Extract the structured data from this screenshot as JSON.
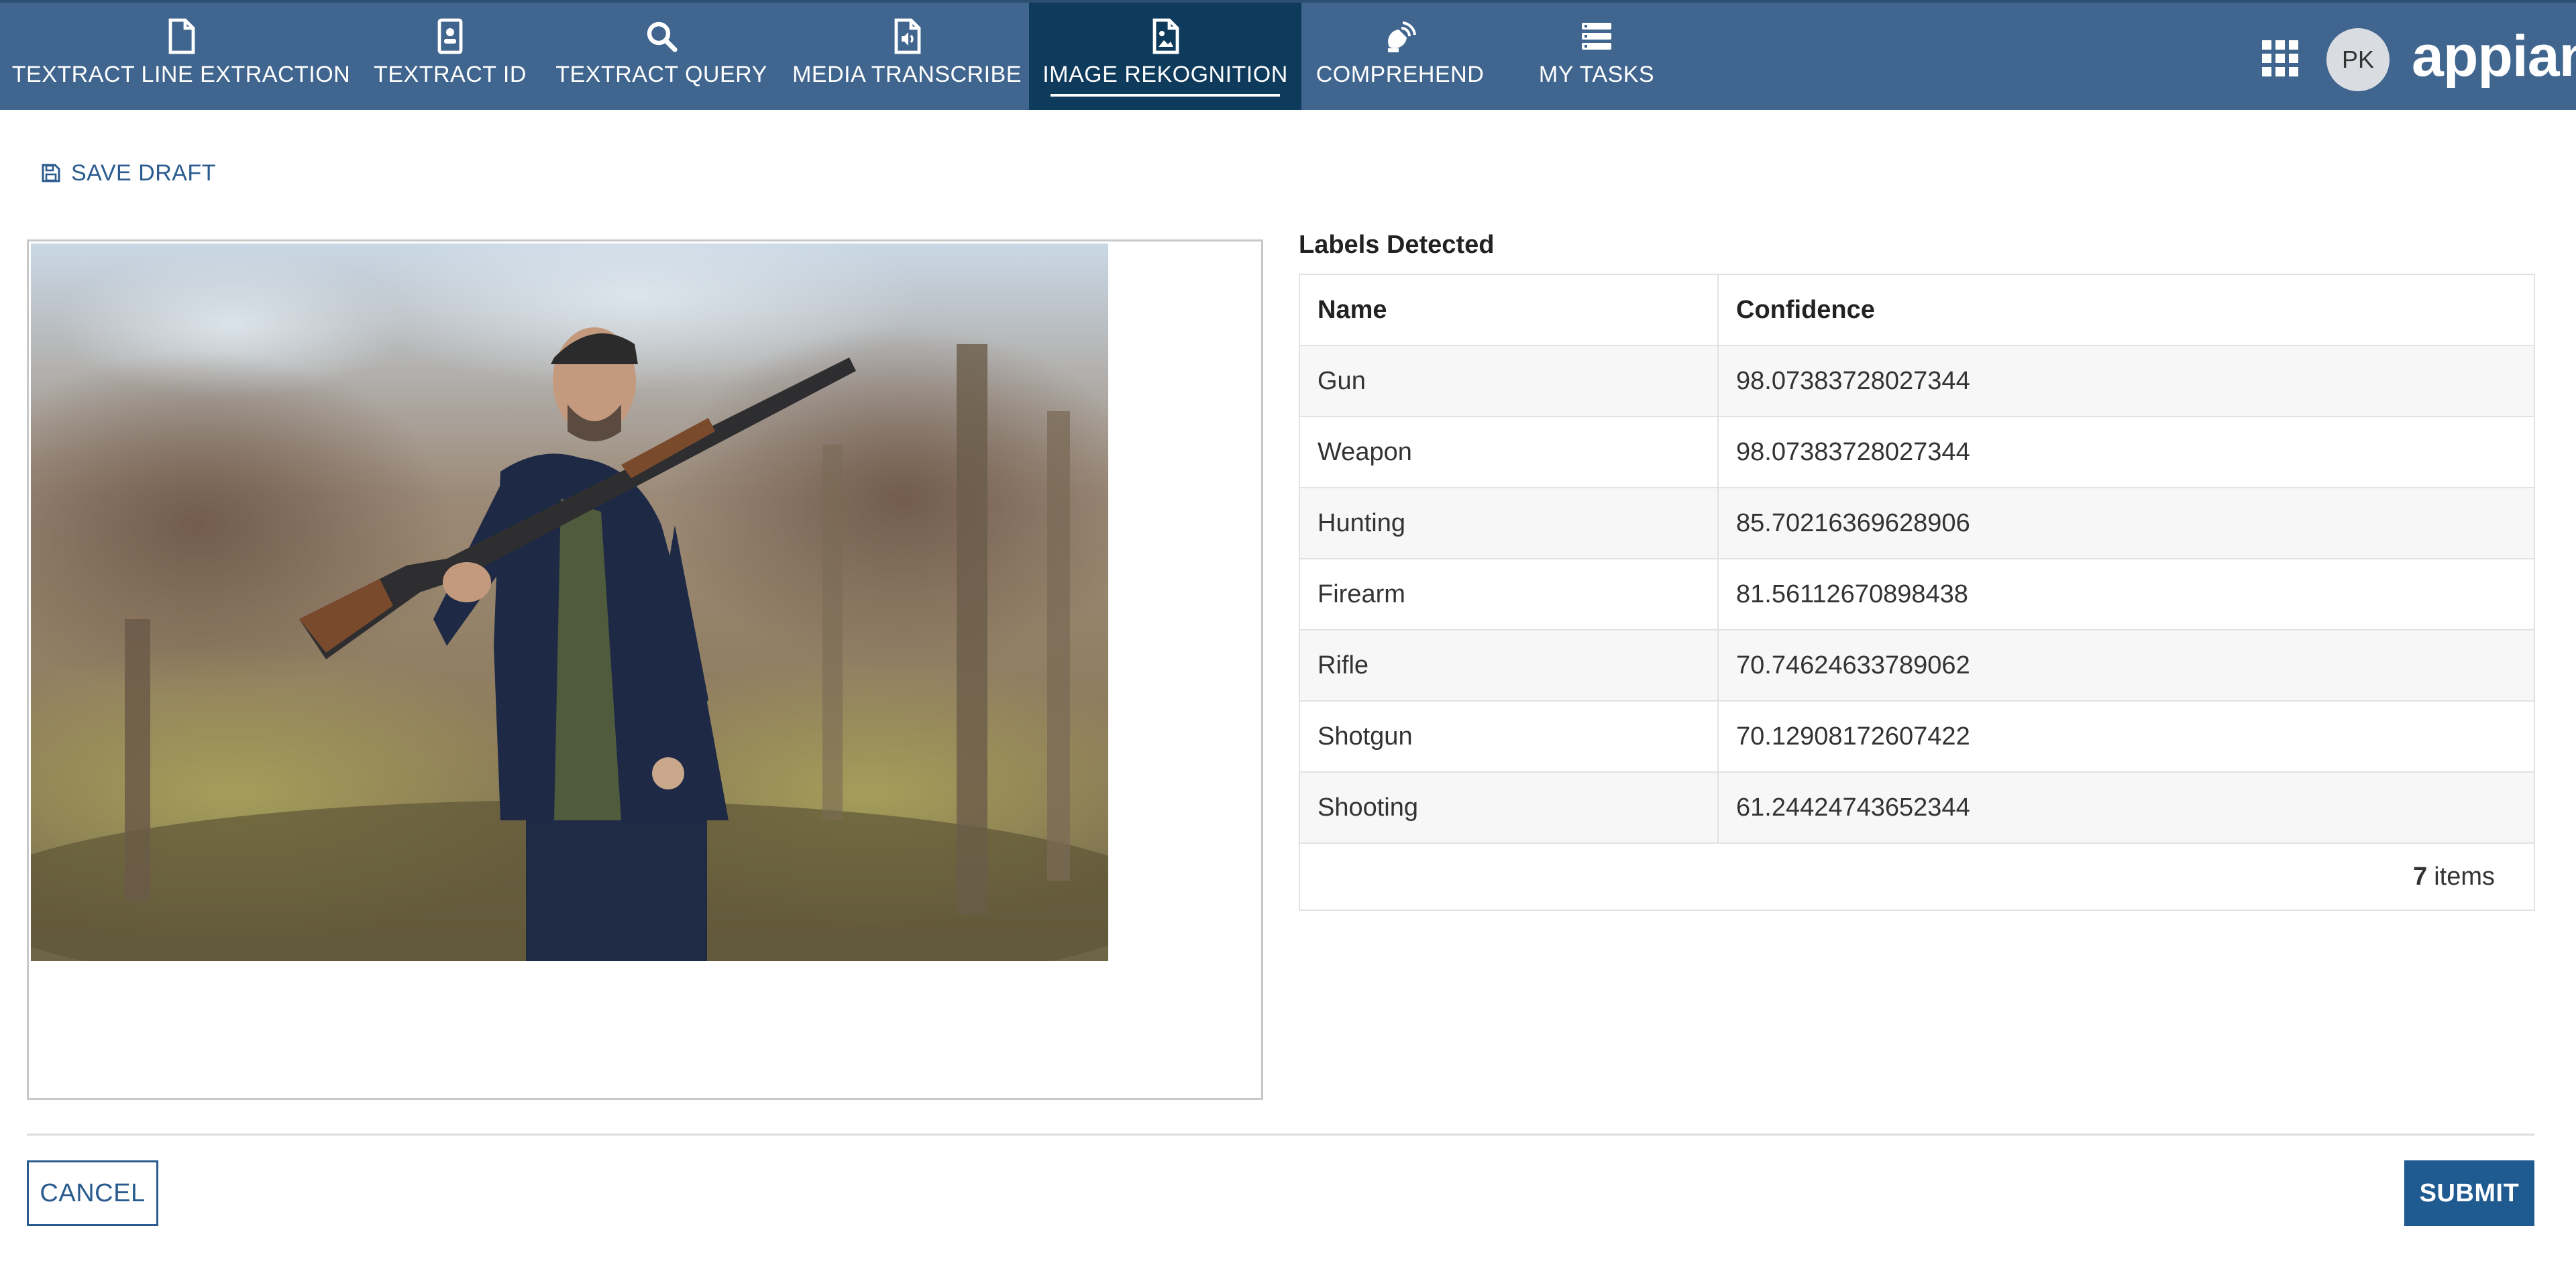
{
  "nav": {
    "tabs": [
      {
        "label": "TEXTRACT LINE EXTRACTION",
        "icon": "document-icon"
      },
      {
        "label": "TEXTRACT ID",
        "icon": "id-card-icon"
      },
      {
        "label": "TEXTRACT QUERY",
        "icon": "search-icon"
      },
      {
        "label": "MEDIA TRANSCRIBE",
        "icon": "audio-file-icon"
      },
      {
        "label": "IMAGE REKOGNITION",
        "icon": "image-file-icon",
        "active": true
      },
      {
        "label": "COMPREHEND",
        "icon": "satellite-icon"
      },
      {
        "label": "MY TASKS",
        "icon": "task-list-icon"
      }
    ],
    "user_initials": "PK",
    "logo": "appian",
    "colors": {
      "bar": "#40668f",
      "active_tab": "#0e3a5c"
    }
  },
  "toolbar": {
    "save_draft_label": "SAVE DRAFT"
  },
  "labels": {
    "heading": "Labels Detected",
    "columns": [
      "Name",
      "Confidence"
    ],
    "rows": [
      {
        "name": "Gun",
        "confidence": "98.07383728027344"
      },
      {
        "name": "Weapon",
        "confidence": "98.07383728027344"
      },
      {
        "name": "Hunting",
        "confidence": "85.70216369628906"
      },
      {
        "name": "Firearm",
        "confidence": "81.56112670898438"
      },
      {
        "name": "Rifle",
        "confidence": "70.74624633789062"
      },
      {
        "name": "Shotgun",
        "confidence": "70.12908172607422"
      },
      {
        "name": "Shooting",
        "confidence": "61.24424743652344"
      }
    ],
    "count": "7",
    "count_suffix": "items"
  },
  "footer": {
    "cancel_label": "CANCEL",
    "submit_label": "SUBMIT",
    "accent": "#1f5a91"
  }
}
